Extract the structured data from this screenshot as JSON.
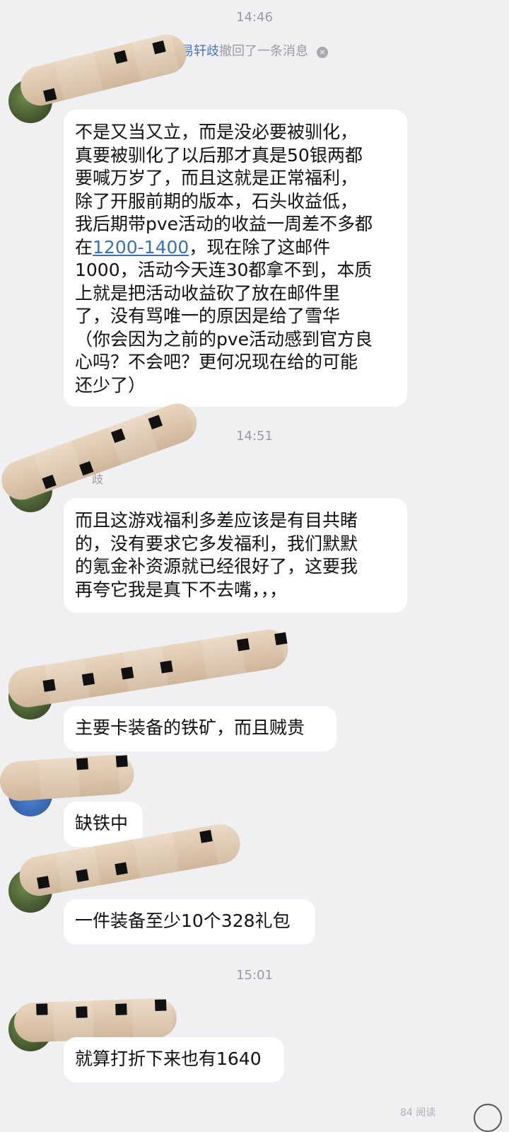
{
  "timestamps": {
    "t1": "14:46",
    "t2": "14:51",
    "t3": "15:01"
  },
  "recall": {
    "who": "易轩歧",
    "text": "撤回了一条消息",
    "close_glyph": "×"
  },
  "nick_fragment": "歧",
  "messages": {
    "m1": {
      "l1": "不是又当又立，而是没必要被驯化，",
      "l2": "真要被驯化了以后那才真是50银两都",
      "l3": "要喊万岁了，而且这就是正常福利，",
      "l4": "除了开服前期的版本，石头收益低，",
      "l5": "我后期带pve活动的收益一周差不多都",
      "l6_pre": "在",
      "l6_link": "1200-1400",
      "l6_post": "，现在除了这邮件",
      "l7": "1000，活动今天连30都拿不到，本质",
      "l8": "上就是把活动收益砍了放在邮件里",
      "l9": "了，没有骂唯一的原因是给了雪华",
      "l10": "（你会因为之前的pve活动感到官方良",
      "l11": "心吗？不会吧？更何况现在给的可能",
      "l12": "还少了）"
    },
    "m2": {
      "l1": "而且这游戏福利多差应该是有目共睹",
      "l2": "的，没有要求它多发福利，我们默默",
      "l3": "的氪金补资源就已经很好了，这要我",
      "l4": "再夸它我是真下不去嘴，，，"
    },
    "m3": "主要卡装备的铁矿，而且贼贵",
    "m4": "缺铁中",
    "m5": "一件装备至少10个328礼包",
    "m6": "就算打折下来也有1640"
  },
  "bottom_note": "84 阅读"
}
